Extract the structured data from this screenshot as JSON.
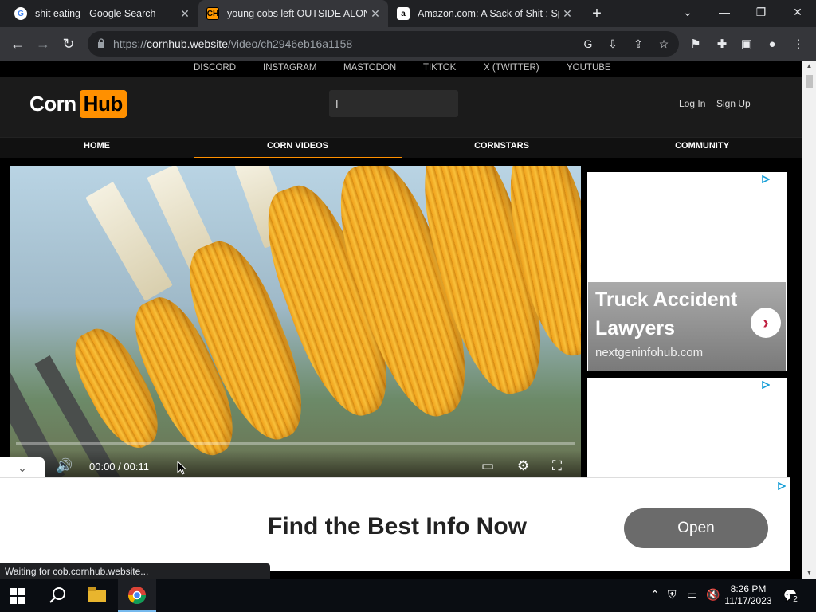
{
  "tabs": [
    {
      "title": "shit eating - Google Search",
      "favicon": "google-icon",
      "active": false
    },
    {
      "title": "young cobs left OUTSIDE ALONE",
      "favicon": "cornhub-icon",
      "active": true
    },
    {
      "title": "Amazon.com: A Sack of Shit : Sp",
      "favicon": "amazon-icon",
      "active": false
    }
  ],
  "address": {
    "scheme": "https://",
    "host": "cornhub.website",
    "path": "/video/ch2946eb16a1158"
  },
  "social_links": [
    "DISCORD",
    "INSTAGRAM",
    "MASTODON",
    "TIKTOK",
    "X (TWITTER)",
    "YOUTUBE"
  ],
  "site": {
    "logo_left": "Corn",
    "logo_right": "Hub",
    "search_value": "I",
    "login": "Log In",
    "signup": "Sign Up",
    "nav": [
      "HOME",
      "CORN VIDEOS",
      "CORNSTARS",
      "COMMUNITY"
    ],
    "nav_active": "CORN VIDEOS",
    "accent": "#ff9000"
  },
  "player": {
    "time": "00:00 / 00:11",
    "progress": 0.0
  },
  "ads": {
    "sidebar_headline": "Truck Accident Lawyers",
    "sidebar_domain": "nextgeninfohub.com",
    "bottom_headline": "Find the Best Info Now",
    "bottom_button": "Open"
  },
  "status_text": "Waiting for cob.cornhub.website...",
  "taskbar": {
    "time": "8:26 PM",
    "date": "11/17/2023",
    "notifications": "2"
  }
}
